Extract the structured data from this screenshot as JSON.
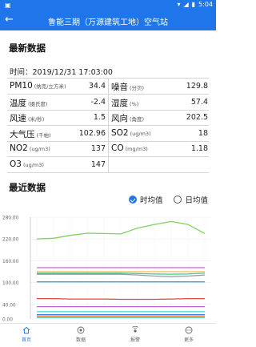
{
  "status_bar": {
    "time": "5:04"
  },
  "header": {
    "title": "鲁能三期（万源建筑工地）空气站"
  },
  "latest": {
    "section_title": "最新数据",
    "time_text": "时间：2019/12/31 17:03:00",
    "rows": [
      [
        {
          "name": "PM10",
          "unit": "(纳克/立方米)",
          "value": "34.4"
        },
        {
          "name": "噪音",
          "unit": "(分贝)",
          "value": "129.8"
        }
      ],
      [
        {
          "name": "温度",
          "unit": "(摄氏度)",
          "value": "-2.4"
        },
        {
          "name": "湿度",
          "unit": "(%)",
          "value": "57.4"
        }
      ],
      [
        {
          "name": "风速",
          "unit": "(米/秒)",
          "value": "1.5"
        },
        {
          "name": "风向",
          "unit": "(角度)",
          "value": "202.5"
        }
      ],
      [
        {
          "name": "大气压",
          "unit": "(千帕)",
          "value": "102.96"
        },
        {
          "name": "SO2",
          "unit": "(ug/m3)",
          "value": "18"
        }
      ],
      [
        {
          "name": "NO2",
          "unit": "(ug/m3)",
          "value": "137"
        },
        {
          "name": "CO",
          "unit": "(mg/m3)",
          "value": "1.18"
        }
      ],
      [
        {
          "name": "O3",
          "unit": "(ug/m3)",
          "value": "147"
        }
      ]
    ]
  },
  "recent": {
    "section_title": "最近数据",
    "options": {
      "hourly": "时均值",
      "daily": "日均值",
      "selected": "hourly"
    }
  },
  "chart_data": {
    "type": "line",
    "ylim": [
      0,
      280
    ],
    "y_ticks": [
      "0.00",
      "40.00",
      "100.00",
      "160.00",
      "220.00",
      "280.00"
    ],
    "y_tick_values": [
      0,
      40,
      100,
      160,
      220,
      280
    ],
    "n_points": 11,
    "series": [
      {
        "color": "#7ed35b",
        "values": [
          220,
          222,
          230,
          236,
          235,
          234,
          250,
          260,
          268,
          260,
          235
        ]
      },
      {
        "color": "#c06ad8",
        "values": [
          141,
          141,
          141,
          141,
          141,
          141,
          141,
          141,
          141,
          141,
          141
        ]
      },
      {
        "color": "#f0b86b",
        "values": [
          130,
          130,
          130,
          130,
          130,
          130,
          130,
          130,
          130,
          130,
          130
        ]
      },
      {
        "color": "#4fcf86",
        "values": [
          126,
          126,
          126,
          126,
          126,
          126,
          125,
          124,
          123,
          124,
          126
        ]
      },
      {
        "color": "#9b9b9b",
        "values": [
          123,
          123,
          123,
          123,
          123,
          123,
          121,
          118,
          116,
          118,
          121
        ]
      },
      {
        "color": "#3ea0e8",
        "values": [
          102,
          102,
          102,
          102,
          102,
          102,
          102,
          102,
          102,
          102,
          102
        ]
      },
      {
        "color": "#e44545",
        "values": [
          56,
          56,
          55,
          55,
          55,
          54,
          54,
          54,
          55,
          56,
          56
        ]
      },
      {
        "color": "#b86bd6",
        "values": [
          34,
          34,
          34,
          34,
          34,
          34,
          34,
          34,
          34,
          34,
          34
        ]
      },
      {
        "color": "#3fd1cf",
        "values": [
          20,
          20,
          20,
          20,
          20,
          20,
          20,
          20,
          20,
          20,
          20
        ]
      },
      {
        "color": "#2f8ce0",
        "values": [
          12,
          12,
          12,
          12,
          12,
          12,
          12,
          12,
          12,
          12,
          12
        ]
      },
      {
        "color": "#ef7d34",
        "values": [
          8,
          8,
          8,
          8,
          8,
          8,
          8,
          8,
          8,
          8,
          8
        ]
      },
      {
        "color": "#35c3a8",
        "values": [
          4,
          4,
          4,
          4,
          4,
          4,
          4,
          4,
          4,
          4,
          4
        ]
      }
    ]
  },
  "tabs": [
    {
      "label": "首页",
      "icon": "home-icon",
      "active": true
    },
    {
      "label": "数据",
      "icon": "data-icon",
      "active": false
    },
    {
      "label": "报警",
      "icon": "alarm-icon",
      "active": false
    },
    {
      "label": "更多",
      "icon": "more-icon",
      "active": false
    }
  ],
  "colors": {
    "primary": "#1f76ea"
  }
}
